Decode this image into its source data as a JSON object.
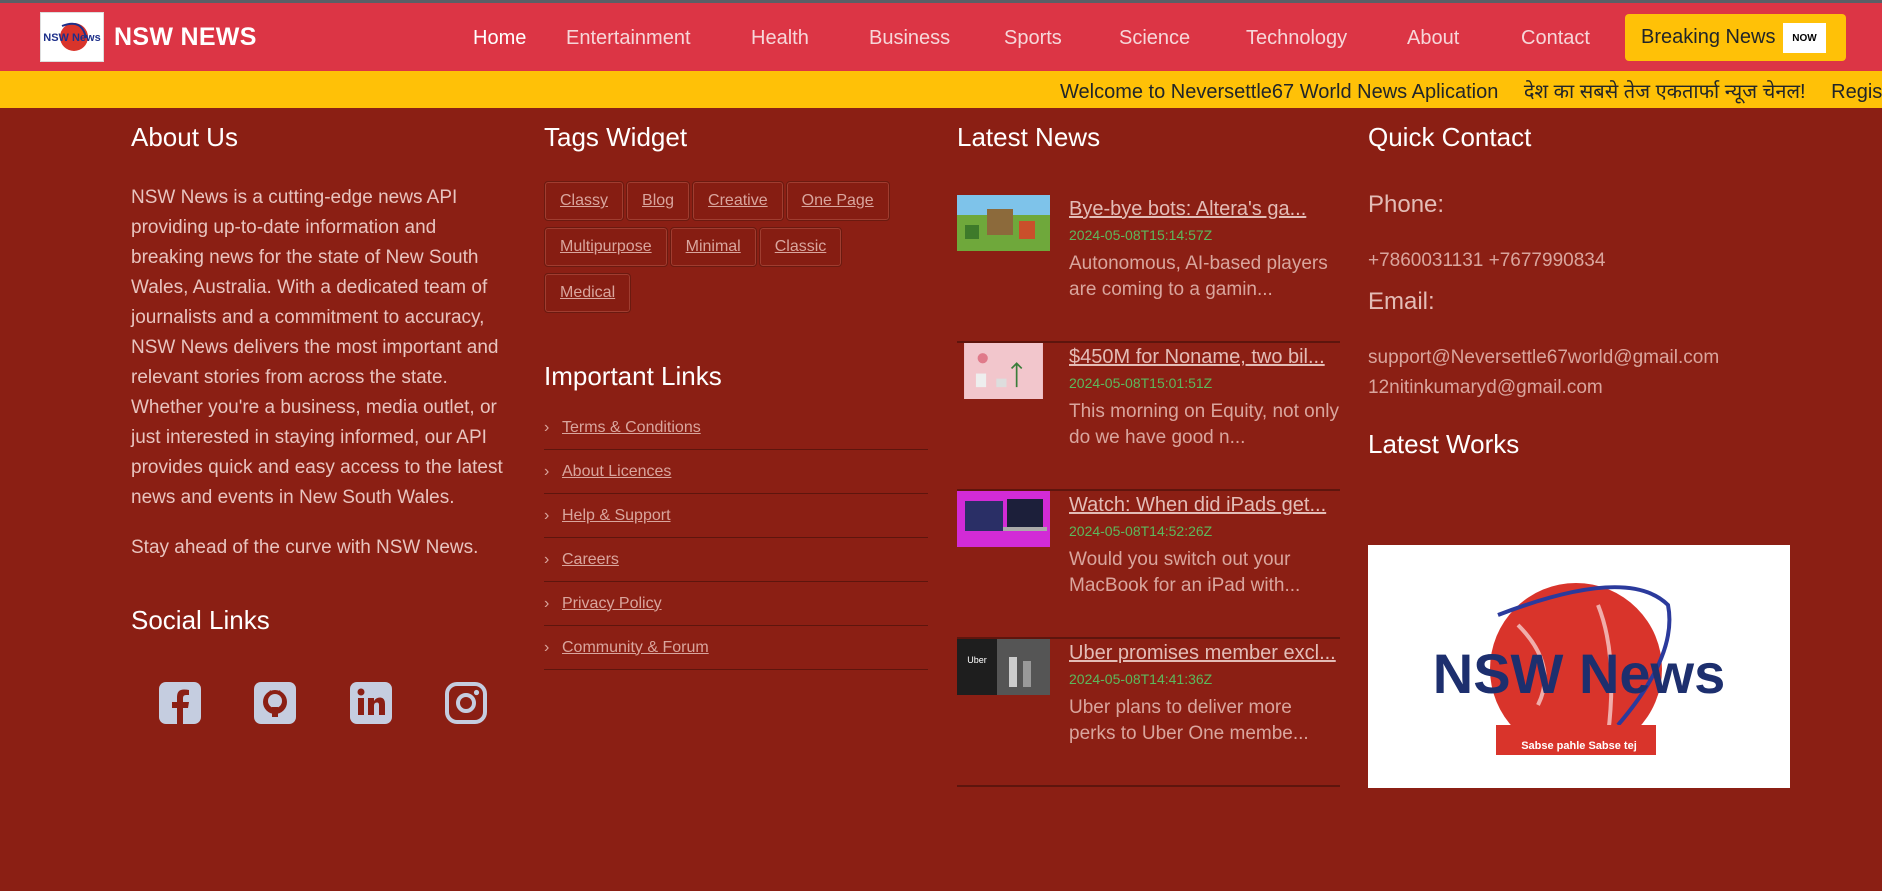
{
  "brand": {
    "logo_text": "NSW News",
    "name": "NSW NEWS"
  },
  "nav": {
    "items": [
      "Home",
      "Entertainment",
      "Health",
      "Business",
      "Sports",
      "Science",
      "Technology",
      "About",
      "Contact"
    ],
    "active": "Home",
    "breaking_label": "Breaking News",
    "now_label": "NOW"
  },
  "ticker": {
    "messages": [
      "Welcome to Neversettle67 World News Aplication",
      "देश का सबसे तेज एकतार्फा न्यूज चेनल!",
      "Regis"
    ]
  },
  "about": {
    "heading": "About Us",
    "body": "NSW News is a cutting-edge news API providing up-to-date information and breaking news for the state of New South Wales, Australia. With a dedicated team of journalists and a commitment to accuracy, NSW News delivers the most important and relevant stories from across the state. Whether you're a business, media outlet, or just interested in staying informed, our API provides quick and easy access to the latest news and events in New South Wales.",
    "tagline": "Stay ahead of the curve with NSW News.",
    "social_heading": "Social Links",
    "social_icons": [
      "facebook-icon",
      "github-icon",
      "linkedin-icon",
      "instagram-icon"
    ]
  },
  "tags": {
    "heading": "Tags Widget",
    "items": [
      "Classy",
      "Blog",
      "Creative",
      "One Page",
      "Multipurpose",
      "Minimal",
      "Classic",
      "Medical"
    ]
  },
  "important_links": {
    "heading": "Important Links",
    "items": [
      "Terms & Conditions",
      "About Licences",
      "Help & Support",
      "Careers",
      "Privacy Policy",
      "Community & Forum"
    ]
  },
  "latest_news": {
    "heading": "Latest News",
    "items": [
      {
        "title": "Bye-bye bots: Altera's ga...",
        "date": "2024-05-08T15:14:57Z",
        "desc": "Autonomous, AI-based players are coming to a gamin..."
      },
      {
        "title": "$450M for Noname, two bil...",
        "date": "2024-05-08T15:01:51Z",
        "desc": "This morning on Equity, not only do we have good n..."
      },
      {
        "title": "Watch: When did iPads get...",
        "date": "2024-05-08T14:52:26Z",
        "desc": "Would you switch out your MacBook for an iPad with..."
      },
      {
        "title": "Uber promises member excl...",
        "date": "2024-05-08T14:41:36Z",
        "desc": "Uber plans to deliver more perks to Uber One membe..."
      }
    ]
  },
  "quick_contact": {
    "heading": "Quick Contact",
    "phone_label": "Phone:",
    "phone": "+7860031131 +7677990834",
    "email_label": "Email:",
    "email_1": "support@Neversettle67world@gmail.com",
    "email_2": "12nitinkumaryd@gmail.com",
    "works_heading": "Latest Works",
    "works_logo_text": "NSW News",
    "works_logo_tagline": "Sabse pahle Sabse tej"
  },
  "colors": {
    "nav_bg": "#dc3545",
    "ticker_bg": "#ffc107",
    "footer_bg": "#8b1f14",
    "date_green": "#5cb85c"
  }
}
